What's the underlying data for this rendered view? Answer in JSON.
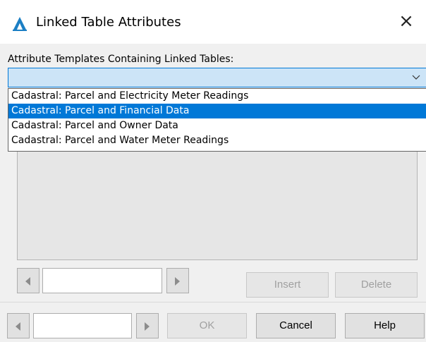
{
  "window": {
    "title": "Linked Table Attributes",
    "close_icon": "close-icon"
  },
  "attributes": {
    "label": "Attribute Templates Containing Linked Tables:",
    "selected_value": "",
    "options": [
      "Cadastral: Parcel and Electricity Meter Readings",
      "Cadastral: Parcel and Financial Data",
      "Cadastral: Parcel and Owner Data",
      "Cadastral: Parcel and Water Meter Readings"
    ],
    "highlighted_index": 1
  },
  "grid_controls": {
    "insert_label": "Insert",
    "delete_label": "Delete"
  },
  "dialog_buttons": {
    "ok_label": "OK",
    "cancel_label": "Cancel",
    "help_label": "Help"
  },
  "colors": {
    "accent": "#0078d7",
    "combo_bg": "#cce4f7",
    "highlight_text": "#ffffff"
  }
}
